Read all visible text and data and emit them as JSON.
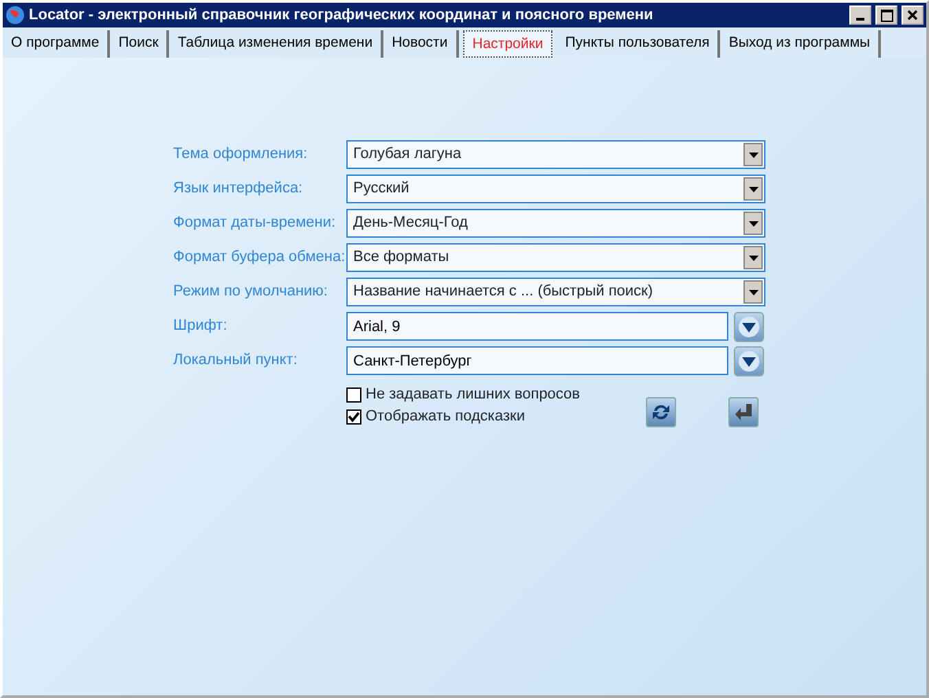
{
  "window": {
    "title": "Locator - электронный справочник географических координат и поясного времени"
  },
  "tabs": [
    {
      "label": "О программе",
      "selected": false
    },
    {
      "label": "Поиск",
      "selected": false
    },
    {
      "label": "Таблица изменения времени",
      "selected": false
    },
    {
      "label": "Новости",
      "selected": false
    },
    {
      "label": "Настройки",
      "selected": true
    },
    {
      "label": "Пункты пользователя",
      "selected": false
    },
    {
      "label": "Выход из программы",
      "selected": false
    }
  ],
  "settings": [
    {
      "label": "Тема оформления:",
      "kind": "select",
      "value": "Голубая лагуна"
    },
    {
      "label": "Язык интерфейса:",
      "kind": "select",
      "value": "Русский"
    },
    {
      "label": "Формат даты-времени:",
      "kind": "select",
      "value": "День-Месяц-Год"
    },
    {
      "label": "Формат буфера обмена:",
      "kind": "select",
      "value": "Все форматы"
    },
    {
      "label": "Режим по умолчанию:",
      "kind": "select",
      "value": "Название начинается с ... (быстрый поиск)"
    },
    {
      "label": "Шрифт:",
      "kind": "picker",
      "value": "Arial, 9"
    },
    {
      "label": "Локальный пункт:",
      "kind": "picker",
      "value": "Санкт-Петербург"
    }
  ],
  "options": [
    {
      "label": "Не задавать лишних вопросов",
      "checked": false
    },
    {
      "label": "Отображать подсказки",
      "checked": true
    }
  ]
}
